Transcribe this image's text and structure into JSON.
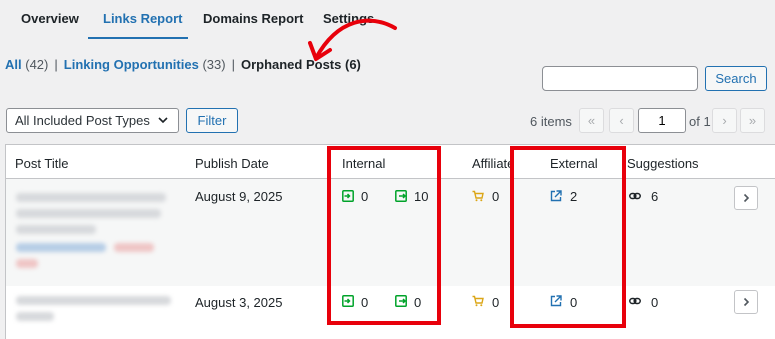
{
  "tabs": [
    {
      "label": "Overview"
    },
    {
      "label": "Links Report"
    },
    {
      "label": "Domains Report"
    },
    {
      "label": "Settings"
    }
  ],
  "filters": {
    "all_label": "All",
    "all_count": "(42)",
    "opps_label": "Linking Opportunities",
    "opps_count": "(33)",
    "orphaned_label": "Orphaned Posts",
    "orphaned_count": "(6)",
    "separator": "|"
  },
  "search": {
    "button": "Search",
    "value": ""
  },
  "bulk": {
    "post_types_selected": "All Included Post Types",
    "filter_button": "Filter"
  },
  "pagination": {
    "items": "6 items",
    "first": "«",
    "prev": "‹",
    "current_page": "1",
    "of_total": "of 1",
    "next": "›",
    "last": "»"
  },
  "table": {
    "headers": [
      "Post Title",
      "Publish Date",
      "Internal",
      "Affiliate",
      "External",
      "Suggestions"
    ],
    "rows": [
      {
        "date": "August 9, 2025",
        "internal_in": "0",
        "internal_out": "10",
        "affiliate": "0",
        "external": "2",
        "suggestions": "6"
      },
      {
        "date": "August 3, 2025",
        "internal_in": "0",
        "internal_out": "0",
        "affiliate": "0",
        "external": "0",
        "suggestions": "0"
      }
    ]
  },
  "colors": {
    "accent": "#2271b1",
    "internal": "#00a32a",
    "affiliate": "#dba617",
    "external": "#2271b1",
    "highlight": "#e8000b"
  },
  "icons": [
    "internal-inbound-icon",
    "internal-outbound-icon",
    "cart-icon",
    "external-link-icon",
    "chain-link-icon",
    "chevron-right-icon",
    "chevron-down-icon"
  ]
}
